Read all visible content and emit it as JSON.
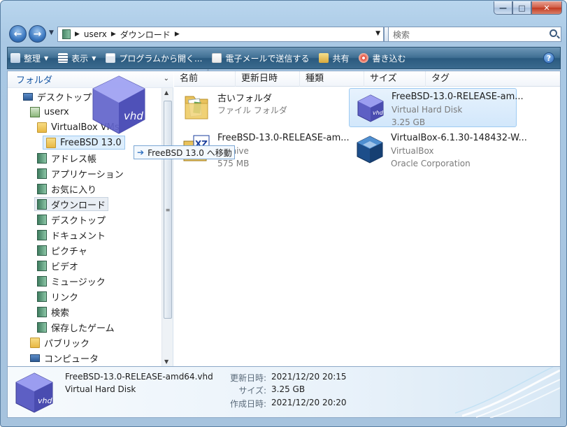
{
  "address": {
    "crumbs": [
      "userx",
      "ダウンロード"
    ]
  },
  "search": {
    "placeholder": "検索"
  },
  "toolbar": {
    "organize": "整理",
    "views": "表示",
    "open_with": "プログラムから開く...",
    "email": "電子メールで送信する",
    "share": "共有",
    "burn": "書き込む"
  },
  "navpane": {
    "header": "フォルダ",
    "items": [
      {
        "label": "デスクトップ"
      },
      {
        "label": "userx"
      },
      {
        "label": "VirtualBox VMs"
      },
      {
        "label": "FreeBSD 13.0"
      },
      {
        "label": "アドレス帳"
      },
      {
        "label": "アプリケーション"
      },
      {
        "label": "お気に入り"
      },
      {
        "label": "ダウンロード"
      },
      {
        "label": "デスクトップ"
      },
      {
        "label": "ドキュメント"
      },
      {
        "label": "ピクチャ"
      },
      {
        "label": "ビデオ"
      },
      {
        "label": "ミュージック"
      },
      {
        "label": "リンク"
      },
      {
        "label": "検索"
      },
      {
        "label": "保存したゲーム"
      },
      {
        "label": "パブリック"
      },
      {
        "label": "コンピュータ"
      }
    ]
  },
  "drag": {
    "tooltip": "FreeBSD 13.0 へ移動"
  },
  "columns": [
    "名前",
    "更新日時",
    "種類",
    "サイズ",
    "タグ"
  ],
  "files": [
    {
      "name": "古いフォルダ",
      "line2": "ファイル フォルダ",
      "line3": ""
    },
    {
      "name": "FreeBSD-13.0-RELEASE-am...",
      "line2": "Virtual Hard Disk",
      "line3": "3.25 GB"
    },
    {
      "name": "FreeBSD-13.0-RELEASE-am...",
      "line2": "Archive",
      "line3": "575 MB"
    },
    {
      "name": "VirtualBox-6.1.30-148432-W...",
      "line2": "VirtualBox",
      "line3": "Oracle Corporation"
    }
  ],
  "details": {
    "name": "FreeBSD-13.0-RELEASE-amd64.vhd",
    "type": "Virtual Hard Disk",
    "modified_label": "更新日時:",
    "modified": "2021/12/20 20:15",
    "size_label": "サイズ:",
    "size": "3.25 GB",
    "created_label": "作成日時:",
    "created": "2021/12/20 20:20"
  },
  "icons": {
    "vhd_text": "vhd",
    "xz_text": "XZ",
    "back": "back-arrow-icon",
    "forward": "forward-arrow-icon"
  }
}
